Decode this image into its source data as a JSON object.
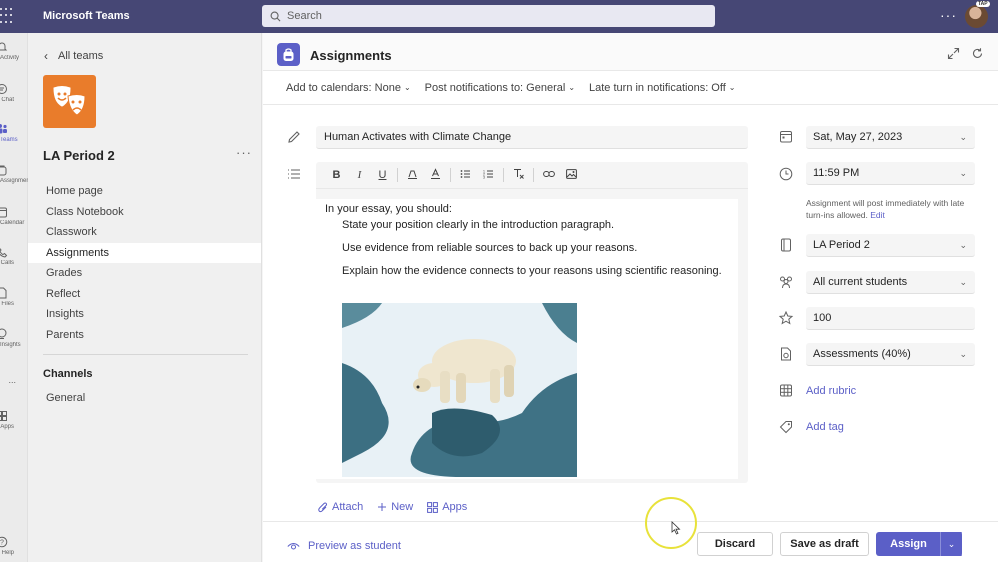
{
  "app": {
    "title": "Microsoft Teams",
    "search_placeholder": "Search",
    "more": "···",
    "avatar_badge": "TAP"
  },
  "rail": [
    {
      "label": "Activity",
      "icon": "bell-icon"
    },
    {
      "label": "Chat",
      "icon": "chat-icon"
    },
    {
      "label": "Teams",
      "icon": "teams-icon"
    },
    {
      "label": "Assignments",
      "icon": "backpack-icon"
    },
    {
      "label": "Calendar",
      "icon": "calendar-icon"
    },
    {
      "label": "Calls",
      "icon": "phone-icon"
    },
    {
      "label": "Files",
      "icon": "file-icon"
    },
    {
      "label": "Insights",
      "icon": "insights-icon"
    },
    {
      "label": "...",
      "icon": "more-icon"
    },
    {
      "label": "Apps",
      "icon": "apps-icon"
    },
    {
      "label": "Help",
      "icon": "help-icon"
    }
  ],
  "team": {
    "back_label": "All teams",
    "name": "LA Period 2",
    "more": "···",
    "nav": [
      "Home page",
      "Class Notebook",
      "Classwork",
      "Assignments",
      "Grades",
      "Reflect",
      "Insights",
      "Parents"
    ],
    "active_nav": "Assignments",
    "channels_heading": "Channels",
    "channels": [
      "General"
    ]
  },
  "main": {
    "title": "Assignments",
    "toolbar": {
      "calendars": "Add to calendars: None",
      "notifications": "Post notifications to: General",
      "late": "Late turn in notifications: Off"
    },
    "assignment_title": "Human Activates with Climate Change",
    "instructions": {
      "intro": "In your essay, you should:",
      "bullets": [
        "State your position clearly in the introduction paragraph.",
        "Use evidence from reliable sources to back up your reasons.",
        "Explain how the evidence connects to your reasons using scientific reasoning."
      ]
    },
    "attach": {
      "attach": "Attach",
      "new": "New",
      "apps": "Apps"
    },
    "right": {
      "date": "Sat, May 27, 2023",
      "time": "11:59 PM",
      "note": "Assignment will post immediately with late turn-ins allowed.",
      "note_edit": "Edit",
      "class": "LA Period 2",
      "students": "All current students",
      "points": "100",
      "category": "Assessments (40%)",
      "add_rubric": "Add rubric",
      "add_tag": "Add tag"
    },
    "footer": {
      "preview": "Preview as student",
      "discard": "Discard",
      "save_draft": "Save as draft",
      "assign": "Assign"
    }
  },
  "colors": {
    "topbar": "#464775",
    "accent": "#5b5fc7",
    "team_logo": "#e97c2b"
  }
}
